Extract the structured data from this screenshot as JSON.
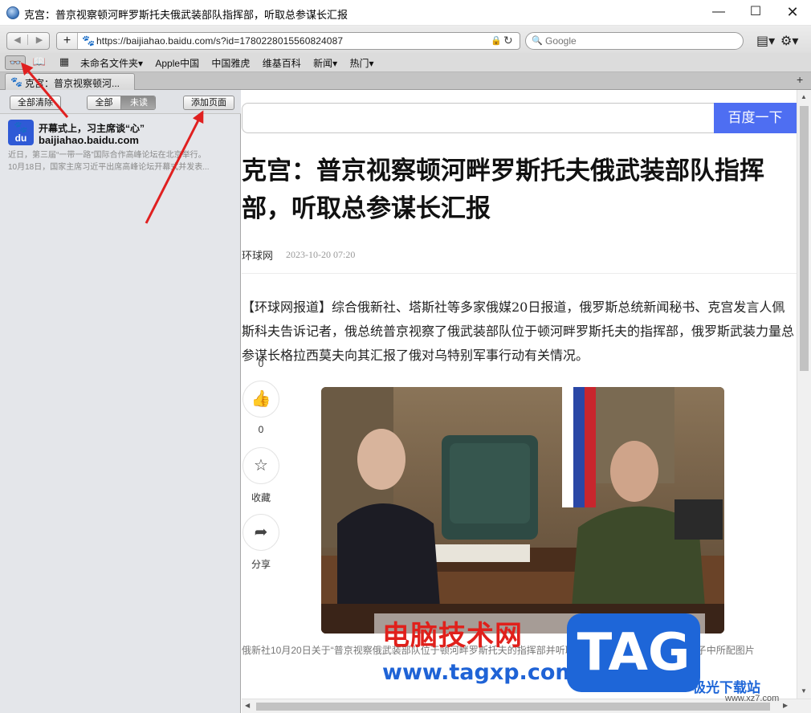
{
  "window": {
    "title": "克宫：普京视察顿河畔罗斯托夫俄武装部队指挥部，听取总参谋长汇报",
    "minimize": "—",
    "maximize": "☐",
    "close": "✕"
  },
  "toolbar": {
    "back": "◀",
    "forward": "▶",
    "add": "+",
    "url": "https://baijiahao.baidu.com/s?id=1780228015560824087",
    "search_placeholder": "Google",
    "page_menu": "▤▾",
    "gear_menu": "⚙▾"
  },
  "bookmarks": {
    "items": [
      "未命名文件夹▾",
      "Apple中国",
      "中国雅虎",
      "维基百科",
      "新闻▾",
      "热门▾"
    ]
  },
  "tabs": {
    "active_label": "克宫：普京视察顿河...",
    "add": "+"
  },
  "sidebar": {
    "clear_all": "全部清除",
    "filter_all": "全部",
    "filter_unread": "未读",
    "add_page": "添加页面",
    "items": [
      {
        "title": "开幕式上，习主席谈“心”",
        "domain": "baijiahao.baidu.com",
        "desc_line1": "近日，第三届“一带一路”国际合作高峰论坛在北京举行。",
        "desc_line2": "10月18日，国家主席习近平出席高峰论坛开幕式并发表..."
      }
    ]
  },
  "page": {
    "search_button": "百度一下",
    "title": "克宫：普京视察顿河畔罗斯托夫俄武装部队指挥部，听取总参谋长汇报",
    "source": "环球网",
    "time": "2023-10-20 07:20",
    "body": "【环球网报道】综合俄新社、塔斯社等多家俄媒20日报道，俄罗斯总统新闻秘书、克宫发言人佩斯科夫告诉记者，俄总统普京视察了俄武装部队位于顿河畔罗斯托夫的指挥部，俄罗斯武装力量总参谋长格拉西莫夫向其汇报了俄对乌特别军事行动有关情况。",
    "caption": "俄新社10月20日关于“普京视察俄武装部队位于顿河畔罗斯托夫的指挥部并听取格拉西莫夫汇报”有关情况”帖子中所配图片",
    "actions": {
      "comment_count": "0",
      "like_count": "0",
      "favorite_label": "收藏",
      "share_label": "分享"
    }
  },
  "watermarks": {
    "site_cn": "电脑技术网",
    "site_url": "www.tagxp.com",
    "tag": "TAG",
    "xz_cn": "极光下载站",
    "xz_url": "www.xz7.com"
  },
  "colors": {
    "accent_blue": "#4e6ef2",
    "arrow_red": "#e02020",
    "sidebar_bg": "#e4e6ea"
  }
}
